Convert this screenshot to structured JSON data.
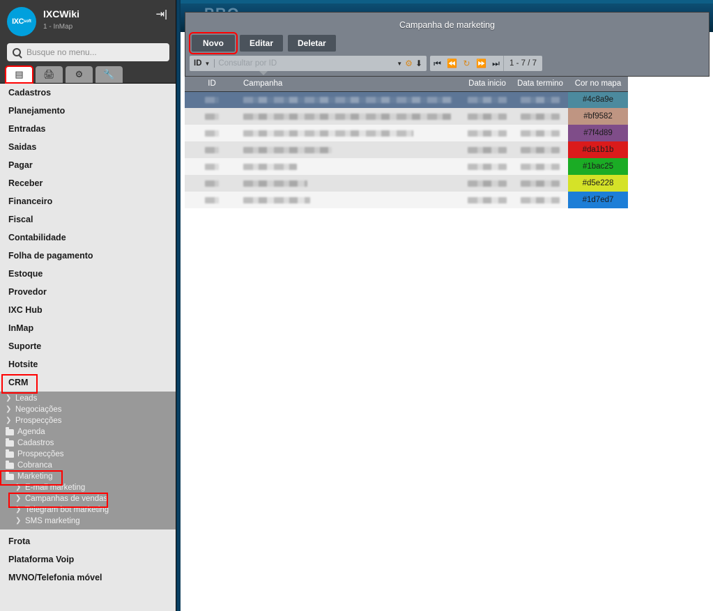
{
  "background": {
    "partial_text": "PRO"
  },
  "sidebar": {
    "brand": {
      "logo_text": "IXC",
      "logo_sub": "soft",
      "title": "IXCWiki",
      "subtitle": "1 - InMap",
      "logout_icon": "logout-icon"
    },
    "search": {
      "placeholder": "Busque no menu...",
      "value": "",
      "icon": "search-icon"
    },
    "icon_buttons": [
      {
        "name": "menu-list-icon",
        "glyph": "▤",
        "active": true
      },
      {
        "name": "printer-icon",
        "glyph": "⎙",
        "active": false
      },
      {
        "name": "gears-icon",
        "glyph": "⚙",
        "active": false
      },
      {
        "name": "wrench-icon",
        "glyph": "🔧",
        "active": false
      }
    ],
    "items_top": [
      {
        "label": "Cadastros"
      },
      {
        "label": "Planejamento"
      },
      {
        "label": "Entradas"
      },
      {
        "label": "Saidas"
      },
      {
        "label": "Pagar"
      },
      {
        "label": "Receber"
      },
      {
        "label": "Financeiro"
      },
      {
        "label": "Fiscal"
      },
      {
        "label": "Contabilidade"
      },
      {
        "label": "Folha de pagamento"
      },
      {
        "label": "Estoque"
      },
      {
        "label": "Provedor"
      },
      {
        "label": "IXC Hub"
      },
      {
        "label": "InMap"
      },
      {
        "label": "Suporte"
      },
      {
        "label": "Hotsite"
      }
    ],
    "crm": {
      "label": "CRM",
      "highlighted": true
    },
    "crm_children": [
      {
        "label": "Leads",
        "icon": "chevron-right-icon",
        "type": "link"
      },
      {
        "label": "Negociações",
        "icon": "chevron-right-icon",
        "type": "link"
      },
      {
        "label": "Prospecções",
        "icon": "chevron-right-icon",
        "type": "link"
      },
      {
        "label": "Agenda",
        "icon": "folder-icon",
        "type": "folder"
      },
      {
        "label": "Cadastros",
        "icon": "folder-icon",
        "type": "folder"
      },
      {
        "label": "Prospecções",
        "icon": "folder-icon",
        "type": "folder"
      },
      {
        "label": "Cobranca",
        "icon": "folder-icon",
        "type": "folder"
      },
      {
        "label": "Marketing",
        "icon": "folder-open-icon",
        "type": "folder-open",
        "highlighted": true
      }
    ],
    "marketing_children": [
      {
        "label": "E-mail marketing",
        "icon": "chevron-right-icon"
      },
      {
        "label": "Campanhas de vendas",
        "icon": "chevron-right-icon",
        "highlighted": true
      },
      {
        "label": "Telegram bot marketing",
        "icon": "chevron-right-icon"
      },
      {
        "label": "SMS marketing",
        "icon": "chevron-right-icon"
      }
    ],
    "items_bottom": [
      {
        "label": "Frota"
      },
      {
        "label": "Plataforma Voip"
      },
      {
        "label": "MVNO/Telefonia móvel"
      }
    ]
  },
  "modal": {
    "title": "Campanha de marketing",
    "buttons": [
      {
        "label": "Novo",
        "name": "novo-button",
        "highlighted": true
      },
      {
        "label": "Editar",
        "name": "editar-button",
        "highlighted": false
      },
      {
        "label": "Deletar",
        "name": "deletar-button",
        "highlighted": false
      }
    ],
    "query": {
      "field_label": "ID",
      "placeholder": "Consultar por ID",
      "value": "",
      "dropdown_icon": "chevron-down-icon",
      "settings_icon": "gear-settings-icon",
      "export_icon": "download-icon"
    },
    "pager": {
      "first_icon": "first-page-icon",
      "prev_icon": "prev-page-icon",
      "refresh_icon": "refresh-icon",
      "next_icon": "next-page-icon",
      "last_icon": "last-page-icon",
      "count_text": "1 - 7 / 7"
    }
  },
  "table": {
    "columns": [
      {
        "key": "id",
        "label": "ID"
      },
      {
        "key": "campanha",
        "label": "Campanha"
      },
      {
        "key": "data_inicio",
        "label": "Data inicio"
      },
      {
        "key": "data_termino",
        "label": "Data termino"
      },
      {
        "key": "cor",
        "label": "Cor no mapa"
      }
    ],
    "rows": [
      {
        "id": "",
        "campanha": "",
        "data_inicio": "",
        "data_termino": "",
        "cor": "#4c8a9e",
        "selected": true
      },
      {
        "id": "",
        "campanha": "",
        "data_inicio": "",
        "data_termino": "",
        "cor": "#bf9582",
        "selected": false
      },
      {
        "id": "",
        "campanha": "",
        "data_inicio": "",
        "data_termino": "",
        "cor": "#7f4d89",
        "selected": false
      },
      {
        "id": "",
        "campanha": "",
        "data_inicio": "",
        "data_termino": "",
        "cor": "#da1b1b",
        "selected": false
      },
      {
        "id": "",
        "campanha": "",
        "data_inicio": "",
        "data_termino": "",
        "cor": "#1bac25",
        "selected": false
      },
      {
        "id": "",
        "campanha": "",
        "data_inicio": "",
        "data_termino": "",
        "cor": "#d5e228",
        "selected": false
      },
      {
        "id": "",
        "campanha": "",
        "data_inicio": "",
        "data_termino": "",
        "cor": "#1d7ed7",
        "selected": false
      }
    ]
  },
  "colors": {
    "sidebar_header": "#3a3a3a",
    "sidebar_body": "#e7e7e7",
    "submenu_bg": "#999999",
    "modal_bg": "#7b828c",
    "button_bg": "#4b535c",
    "highlight": "#ff0000",
    "brand_blue": "#00a0dd",
    "row_selected": "#5d7696"
  }
}
